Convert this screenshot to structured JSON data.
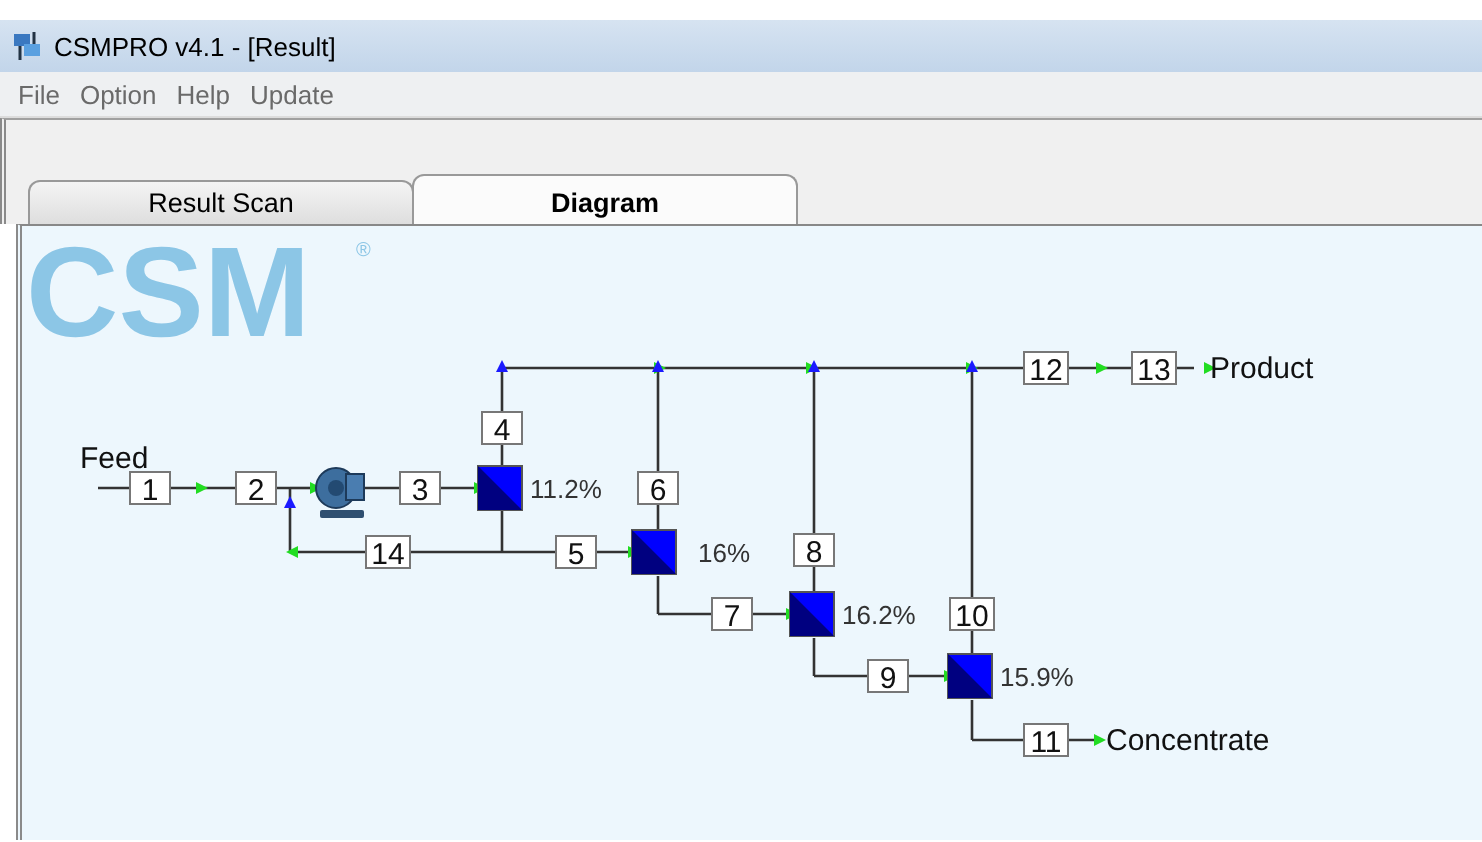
{
  "window": {
    "title": "CSMPRO v4.1 - [Result]"
  },
  "menu": [
    {
      "label": "File"
    },
    {
      "label": "Option"
    },
    {
      "label": "Help"
    },
    {
      "label": "Update"
    }
  ],
  "tabs": [
    {
      "label": "Result Scan",
      "selected": false
    },
    {
      "label": "Diagram",
      "selected": true
    }
  ],
  "diagram": {
    "logo": {
      "text": "CSM",
      "mark": "®"
    },
    "feed_label": "Feed",
    "product_label": "Product",
    "concentrate_label": "Concentrate",
    "streams": [
      {
        "label": "1"
      },
      {
        "label": "2"
      },
      {
        "label": "3"
      },
      {
        "label": "4"
      },
      {
        "label": "14"
      },
      {
        "label": "5"
      },
      {
        "label": "6"
      },
      {
        "label": "7"
      },
      {
        "label": "8"
      },
      {
        "label": "9"
      },
      {
        "label": "10"
      },
      {
        "label": "11"
      },
      {
        "label": "12"
      },
      {
        "label": "13"
      }
    ],
    "membranes": [
      {
        "recovery": "11.2%"
      },
      {
        "recovery": "16%"
      },
      {
        "recovery": "16.2%"
      },
      {
        "recovery": "15.9%"
      }
    ]
  }
}
